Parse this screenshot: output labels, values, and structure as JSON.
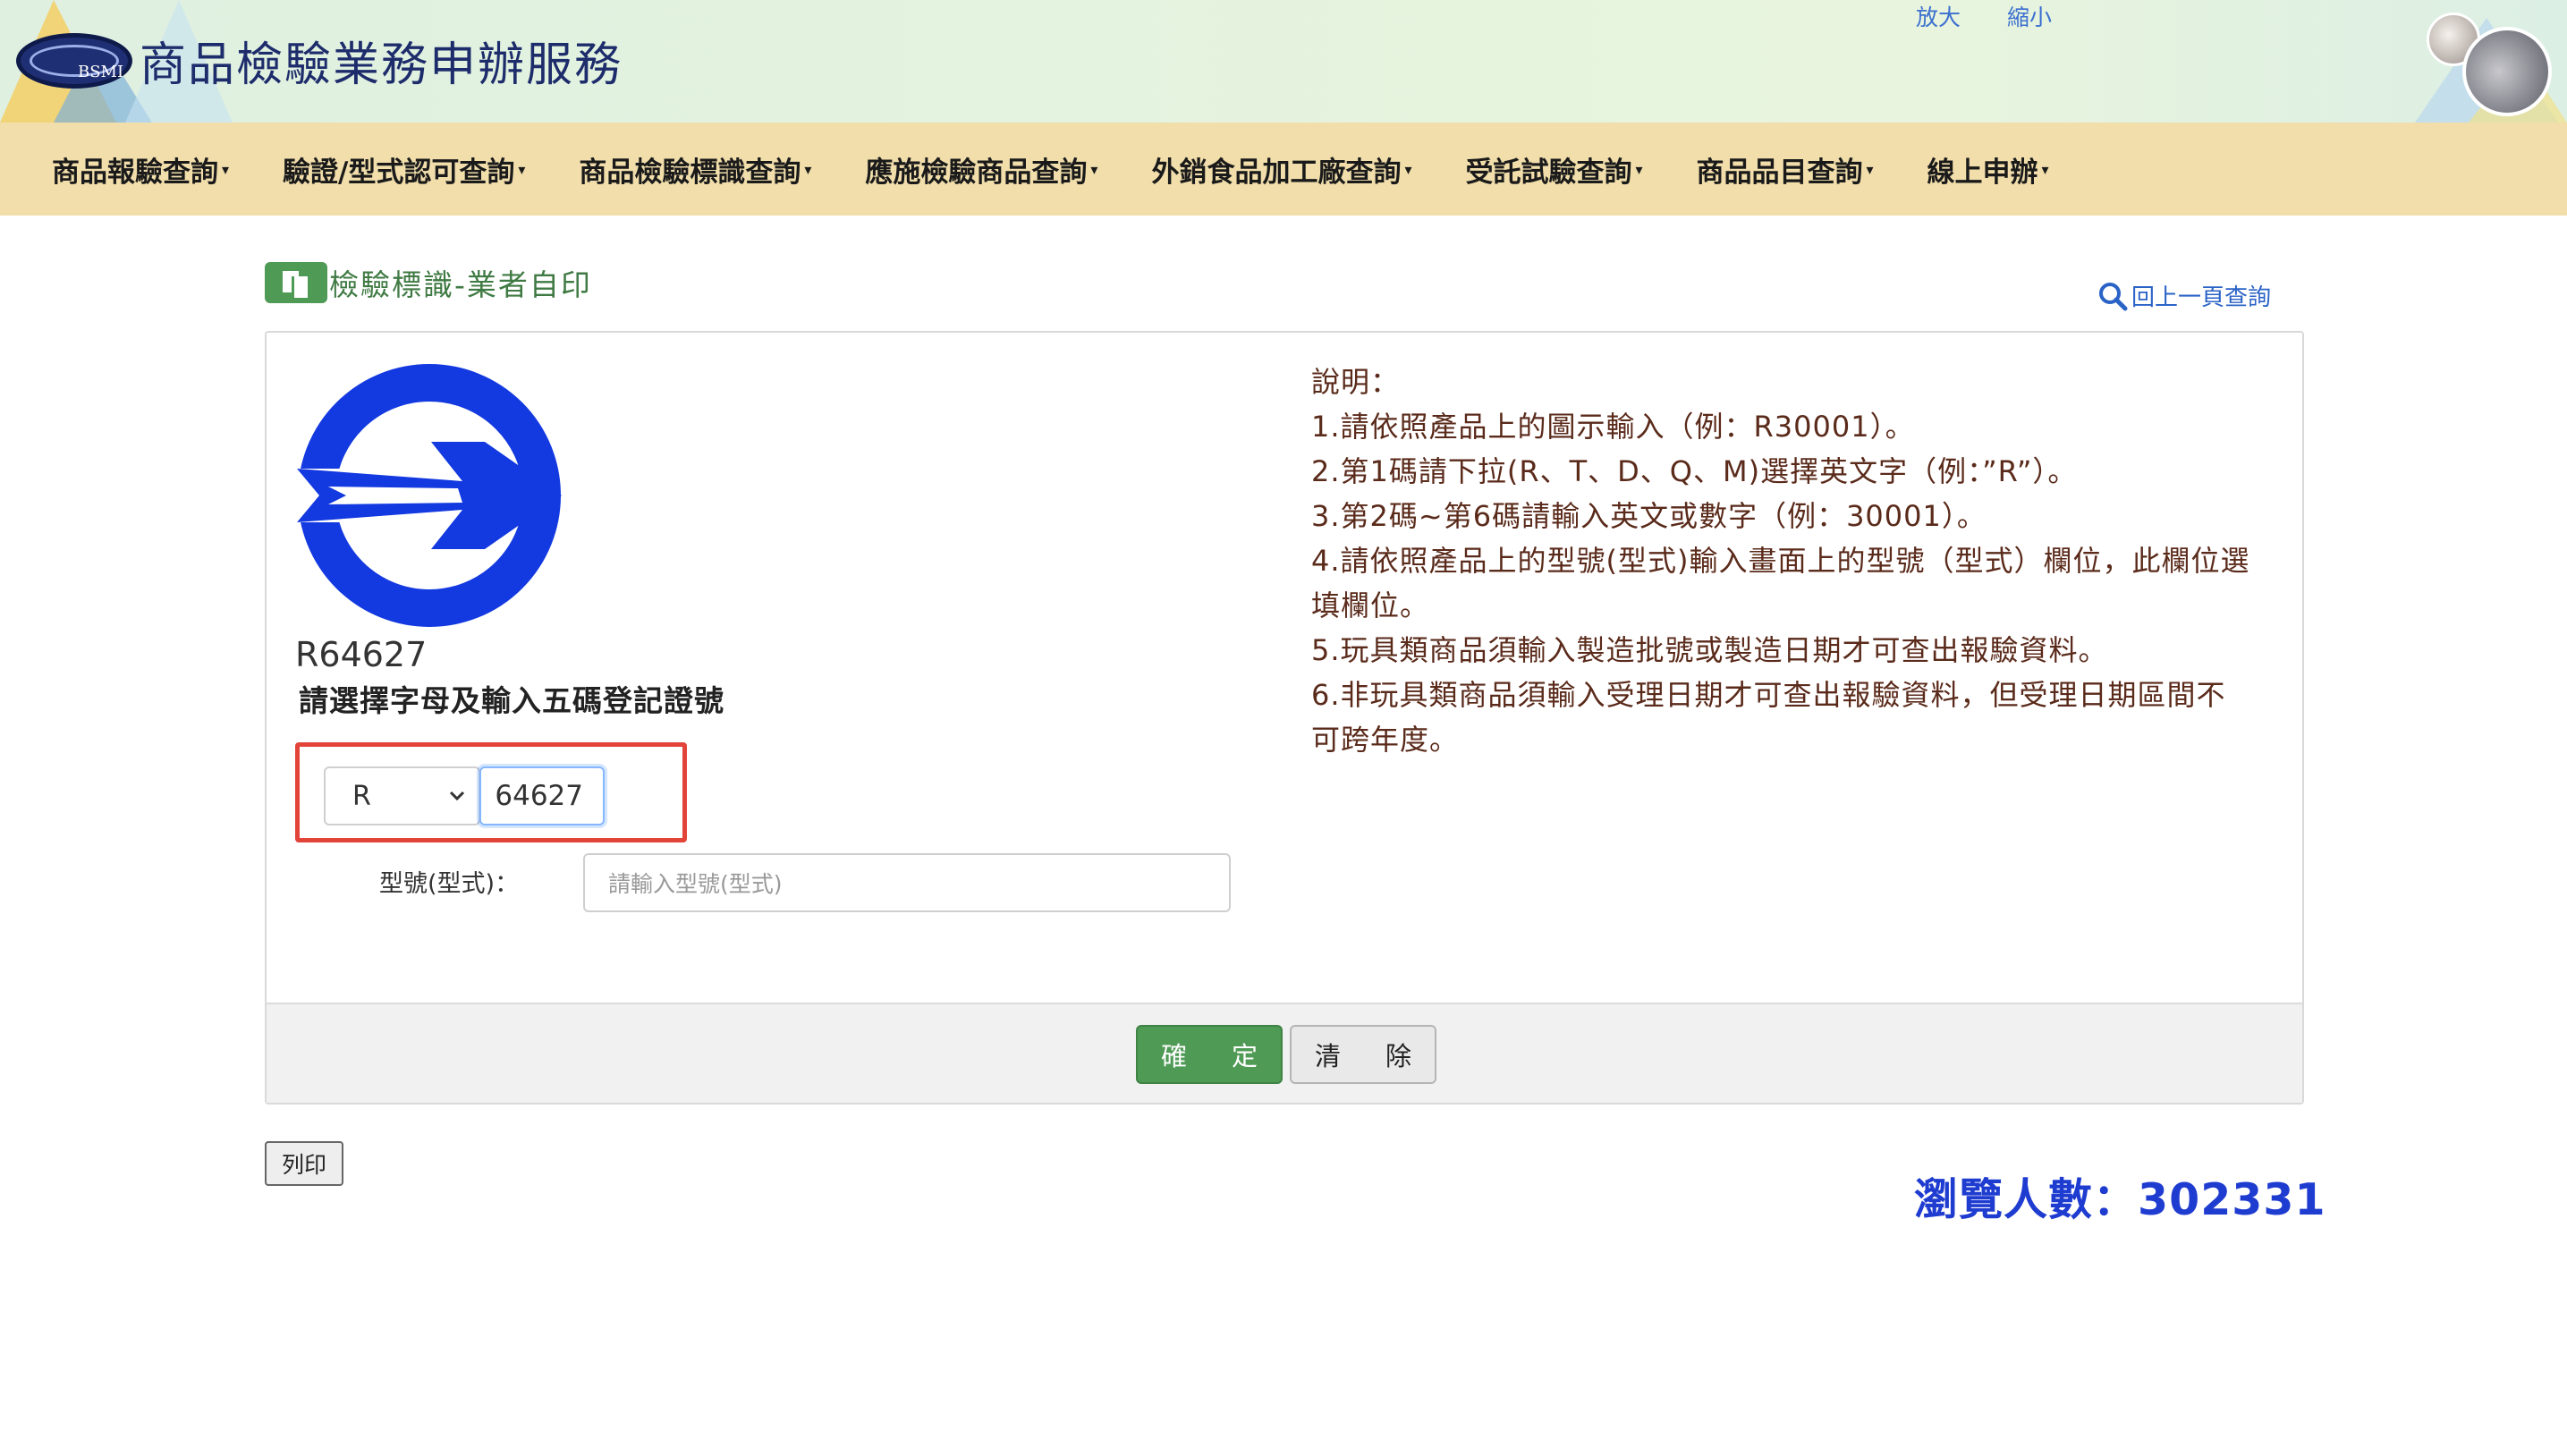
{
  "header": {
    "site_title": "商品檢驗業務申辦服務",
    "logo_text": "BSMI",
    "zoom_in": "放大",
    "zoom_out": "縮小"
  },
  "nav": {
    "items": [
      {
        "label": "商品報驗查詢"
      },
      {
        "label": "驗證/型式認可查詢"
      },
      {
        "label": "商品檢驗標識查詢"
      },
      {
        "label": "應施檢驗商品查詢"
      },
      {
        "label": "外銷食品加工廠查詢"
      },
      {
        "label": "受託試驗查詢"
      },
      {
        "label": "商品品目查詢"
      },
      {
        "label": "線上申辦"
      }
    ]
  },
  "section": {
    "title": "檢驗標識-業者自印",
    "back_link": "回上一頁查詢"
  },
  "form": {
    "registration_code": "R64627",
    "instruction": "請選擇字母及輸入五碼登記證號",
    "letter_value": "R",
    "code_value": "64627",
    "model_label": "型號(型式)：",
    "model_placeholder": "請輸入型號(型式)",
    "confirm_label_1": "確",
    "confirm_label_2": "定",
    "clear_label_1": "清",
    "clear_label_2": "除"
  },
  "description": {
    "heading": "說明：",
    "lines": [
      "1.請依照產品上的圖示輸入（例：R30001）。",
      "2.第1碼請下拉(R、T、D、Q、M)選擇英文字（例：”R”）。",
      "3.第2碼~第6碼請輸入英文或數字（例：30001）。",
      "4.請依照產品上的型號(型式)輸入畫面上的型號（型式）欄位，此欄位選填欄位。",
      "5.玩具類商品須輸入製造批號或製造日期才可查出報驗資料。",
      "6.非玩具類商品須輸入受理日期才可查出報驗資料，但受理日期區間不可跨年度。"
    ]
  },
  "footer": {
    "print_label": "列印",
    "visitors_text": "瀏覽人數：302331"
  },
  "colors": {
    "mark_blue": "#1339e0",
    "nav_bg": "#f1deab",
    "accent_green": "#4f9a55",
    "visitor_blue": "#1f3cd0",
    "description_text": "#5a2a1a"
  }
}
